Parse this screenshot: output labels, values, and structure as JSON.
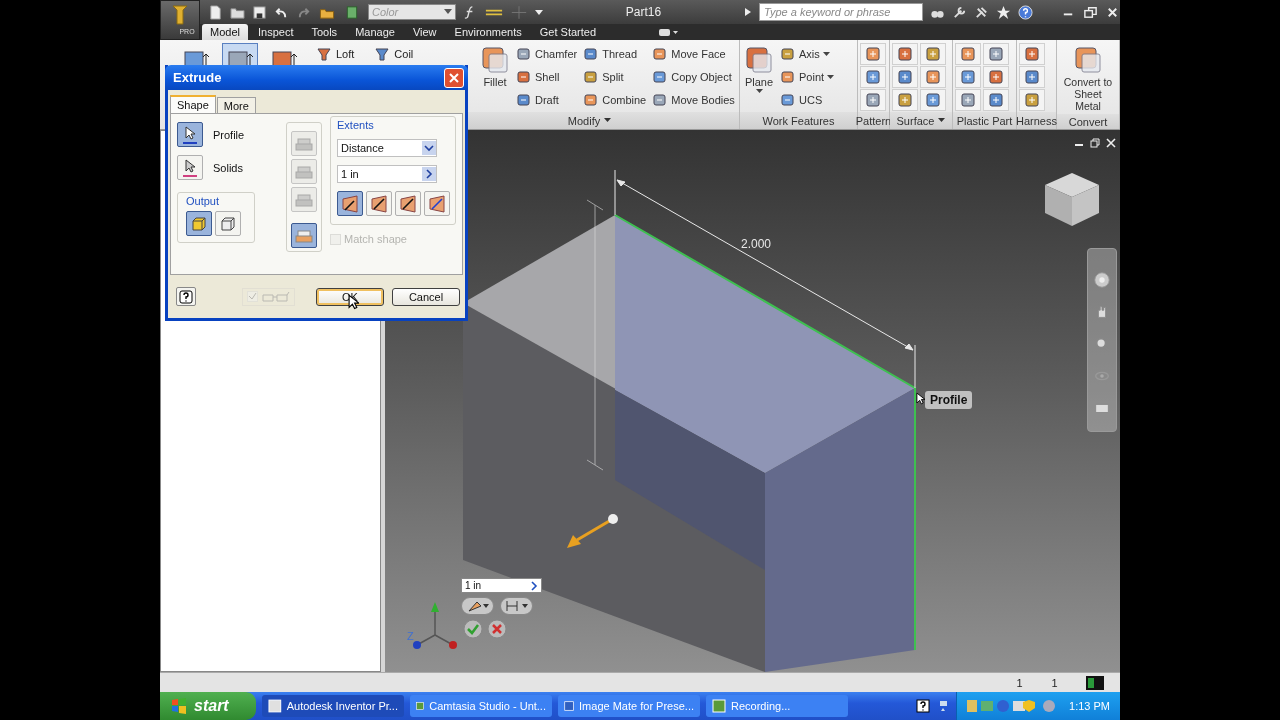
{
  "title_bar": {
    "app_badge": "PRO",
    "color_field": "Color",
    "document": "Part16",
    "search": {
      "placeholder": "Type a keyword or phrase"
    }
  },
  "tabs": [
    {
      "label": "Model",
      "selected": true
    },
    {
      "label": "Inspect",
      "selected": false
    },
    {
      "label": "Tools",
      "selected": false
    },
    {
      "label": "Manage",
      "selected": false
    },
    {
      "label": "View",
      "selected": false
    },
    {
      "label": "Environments",
      "selected": false
    },
    {
      "label": "Get Started",
      "selected": false
    }
  ],
  "ribbon": {
    "create_items": [
      {
        "kind": "icon",
        "selected": false
      },
      {
        "kind": "icon",
        "selected": true
      },
      {
        "kind": "icon",
        "selected": false
      },
      {
        "kind": "small",
        "label": "Loft",
        "selected": false
      },
      {
        "kind": "small",
        "label": "Coil",
        "selected": false
      }
    ],
    "panels": [
      {
        "label": "Modify",
        "dropdown": true,
        "columns": [
          [
            {
              "kind": "large",
              "label": "Fillet",
              "dropdown": false
            }
          ],
          [
            {
              "kind": "small",
              "label": "Chamfer",
              "dropdown": false
            },
            {
              "kind": "small",
              "label": "Shell",
              "dropdown": false
            },
            {
              "kind": "small",
              "label": "Draft",
              "dropdown": false
            }
          ],
          [
            {
              "kind": "small",
              "label": "Thread",
              "dropdown": false
            },
            {
              "kind": "small",
              "label": "Split",
              "dropdown": false
            },
            {
              "kind": "small",
              "label": "Combine",
              "dropdown": false
            }
          ],
          [
            {
              "kind": "small",
              "label": "Move Face",
              "dropdown": false
            },
            {
              "kind": "small",
              "label": "Copy Object",
              "dropdown": false
            },
            {
              "kind": "small",
              "label": "Move Bodies",
              "dropdown": false
            }
          ]
        ]
      },
      {
        "label": "Work Features",
        "dropdown": false,
        "columns": [
          [
            {
              "kind": "large",
              "label": "Plane",
              "dropdown": true
            }
          ],
          [
            {
              "kind": "small",
              "label": "Axis",
              "dropdown": true
            },
            {
              "kind": "small",
              "label": "Point",
              "dropdown": true
            },
            {
              "kind": "small",
              "label": "UCS",
              "dropdown": false
            }
          ]
        ]
      },
      {
        "label": "Pattern",
        "dropdown": false,
        "columns": [
          [
            {
              "kind": "icon"
            },
            {
              "kind": "icon"
            },
            {
              "kind": "icon"
            }
          ]
        ]
      },
      {
        "label": "Surface",
        "dropdown": true,
        "columns": [
          [
            {
              "kind": "icon"
            },
            {
              "kind": "icon"
            },
            {
              "kind": "icon"
            }
          ],
          [
            {
              "kind": "icon"
            },
            {
              "kind": "icon"
            },
            {
              "kind": "icon"
            }
          ]
        ]
      },
      {
        "label": "Plastic Part",
        "dropdown": false,
        "columns": [
          [
            {
              "kind": "icon"
            },
            {
              "kind": "icon"
            },
            {
              "kind": "icon"
            }
          ],
          [
            {
              "kind": "icon"
            },
            {
              "kind": "icon"
            },
            {
              "kind": "icon"
            }
          ]
        ]
      },
      {
        "label": "Harness",
        "dropdown": false,
        "columns": [
          [
            {
              "kind": "icon"
            },
            {
              "kind": "icon"
            },
            {
              "kind": "icon"
            }
          ]
        ]
      },
      {
        "label": "Convert",
        "dropdown": false,
        "columns": [
          [
            {
              "kind": "large",
              "label": "Convert to Sheet Metal",
              "dropdown": false
            }
          ]
        ]
      }
    ]
  },
  "dialog": {
    "title": "Extrude",
    "tabs": [
      {
        "label": "Shape",
        "selected": true
      },
      {
        "label": "More",
        "selected": false
      }
    ],
    "inputs": [
      {
        "label": "Profile",
        "selected": true
      },
      {
        "label": "Solids",
        "selected": false
      }
    ],
    "output": {
      "label": "Output",
      "options": [
        {
          "selected": true
        },
        {
          "selected": false
        }
      ]
    },
    "operations": [
      {
        "selected": false,
        "disabled": true
      },
      {
        "selected": false,
        "disabled": true
      },
      {
        "selected": false,
        "disabled": true
      },
      {
        "selected": true,
        "disabled": false
      }
    ],
    "extents": {
      "label": "Extents",
      "type": "Distance",
      "distance": "1 in",
      "directions": [
        {
          "selected": true
        },
        {
          "selected": false
        },
        {
          "selected": false
        },
        {
          "selected": false
        }
      ]
    },
    "match_shape": {
      "label": "Match shape",
      "checked": false,
      "disabled": true
    },
    "preview": {
      "checked": true,
      "disabled": true
    },
    "buttons": [
      {
        "label": "OK",
        "kind": "default"
      },
      {
        "label": "Cancel",
        "kind": "normal"
      }
    ]
  },
  "viewport": {
    "dimension": "2.000",
    "tooltip": "Profile",
    "distance_field": "1 in",
    "axis_label": "Z"
  },
  "status_bar": {
    "counts": [
      "1",
      "1"
    ]
  },
  "taskbar": {
    "start": "start",
    "tasks": [
      {
        "label": "Autodesk Inventor Pr...",
        "selected": true
      },
      {
        "label": "Camtasia Studio - Unt...",
        "selected": false
      },
      {
        "label": "Image Mate for Prese...",
        "selected": false
      },
      {
        "label": "Recording...",
        "selected": false
      }
    ],
    "clock": "1:13 PM"
  }
}
